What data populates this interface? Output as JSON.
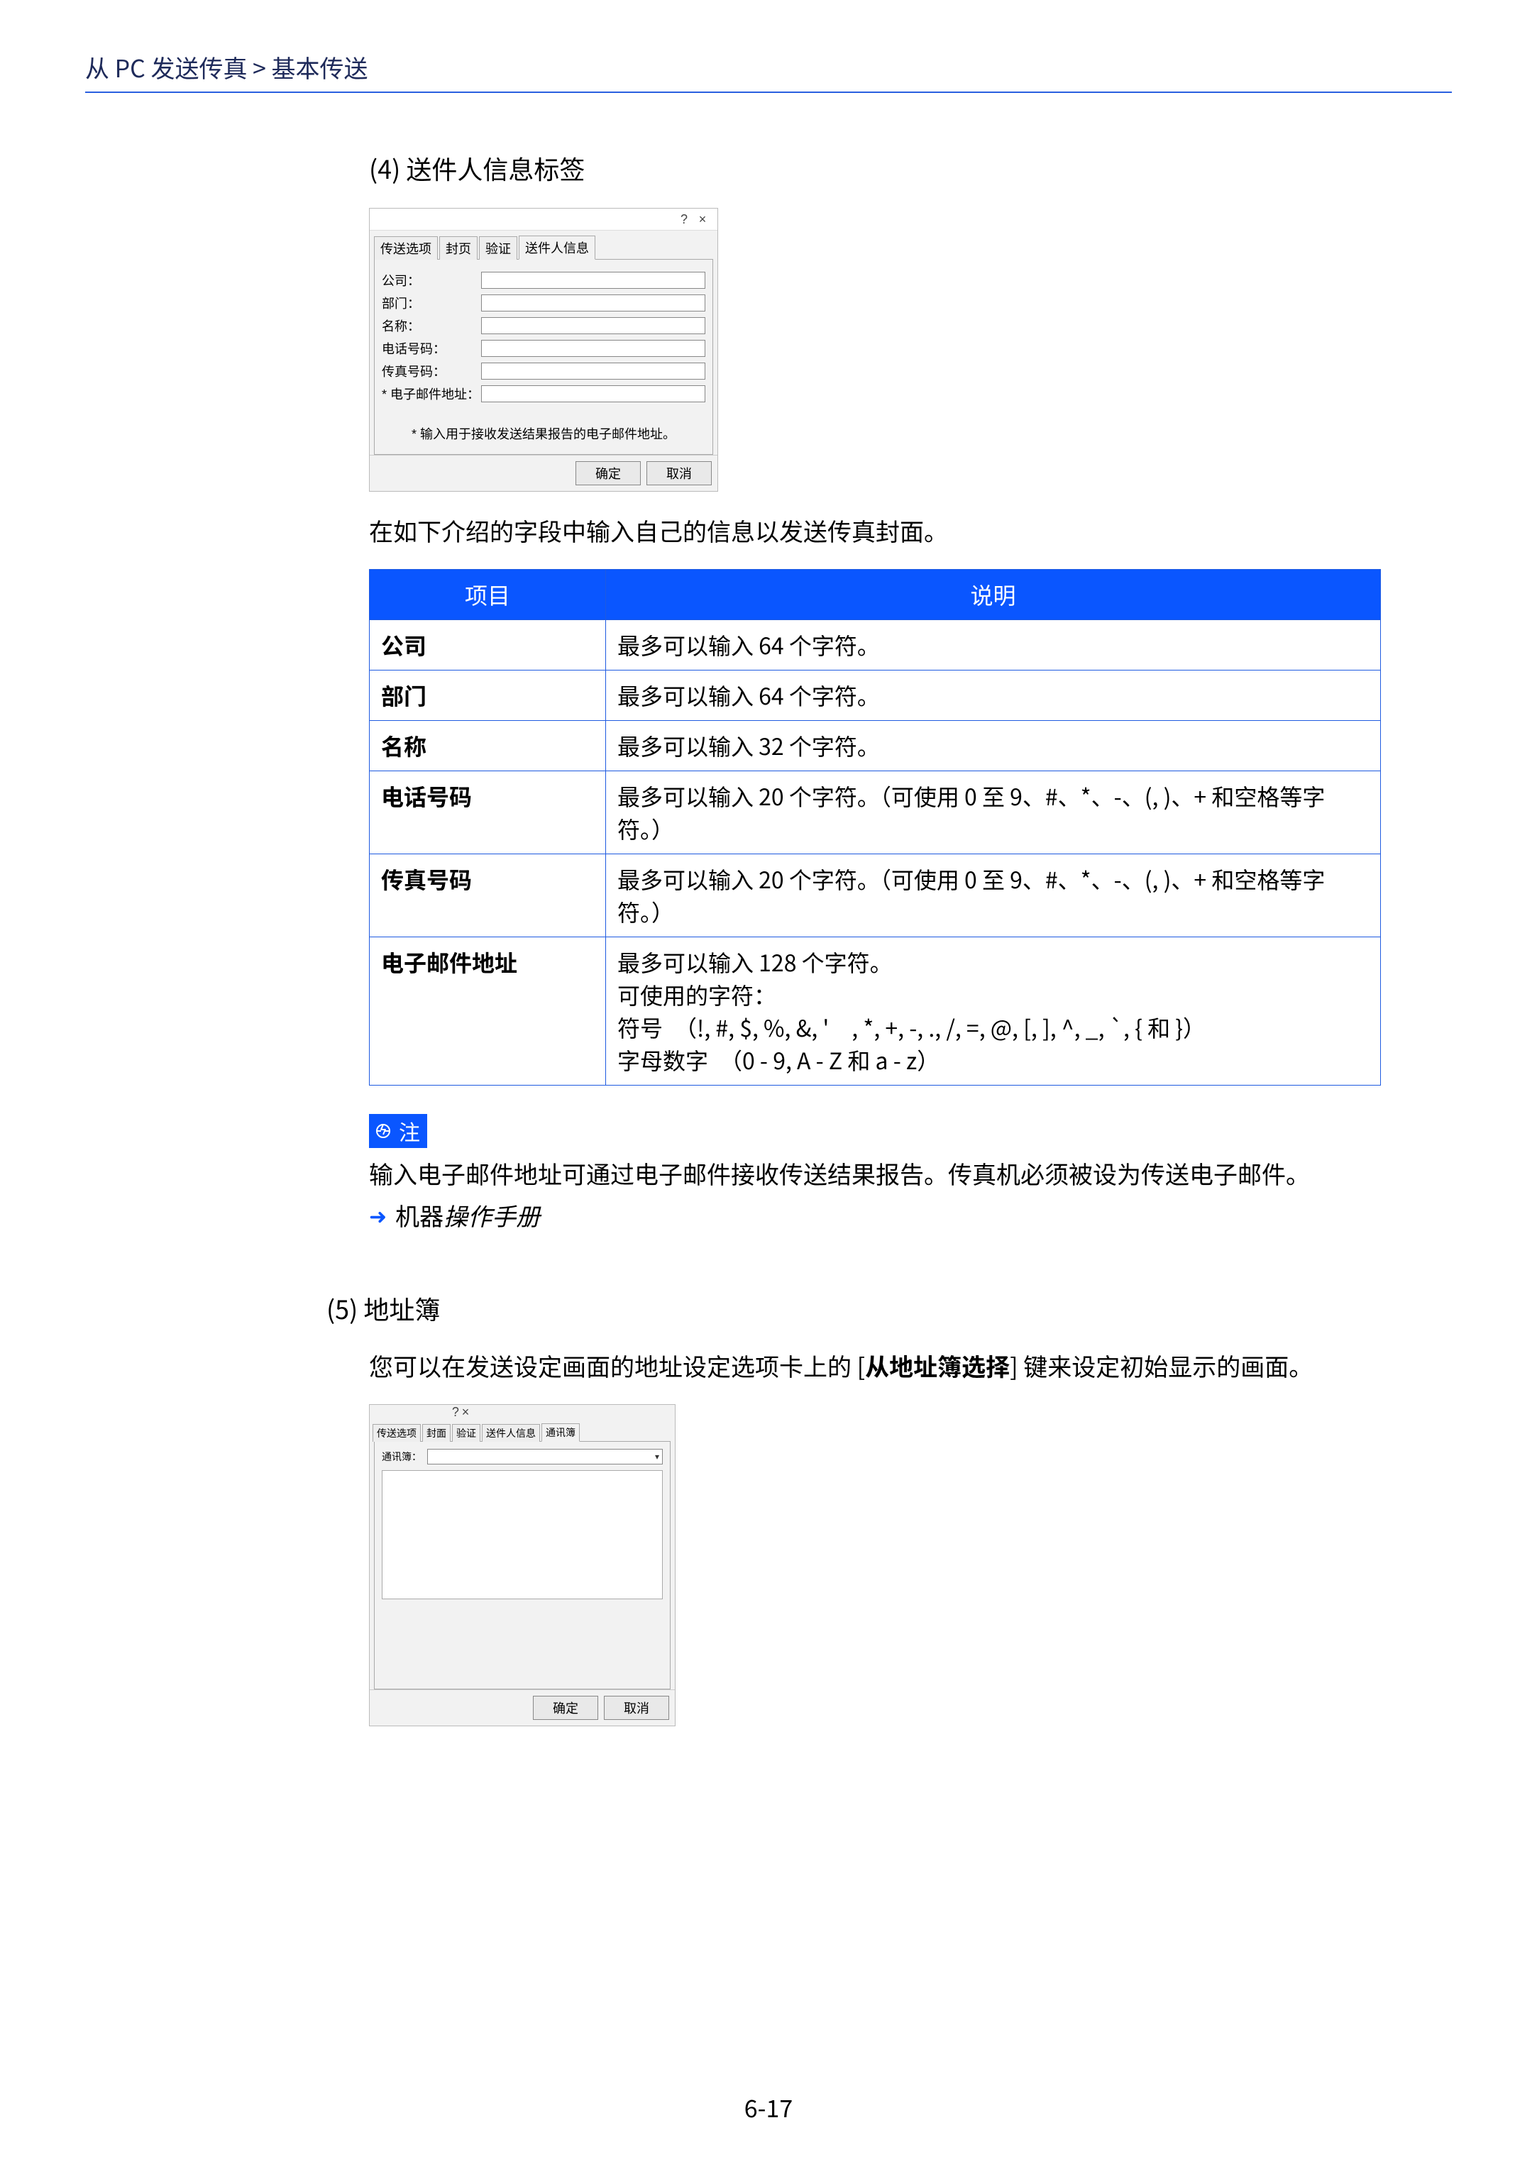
{
  "breadcrumb": "从 PC 发送传真 > 基本传送",
  "section4": {
    "heading": "(4) 送件人信息标签",
    "dialog": {
      "help": "?",
      "close": "×",
      "tabs": {
        "t1": "传送选项",
        "t2": "封页",
        "t3": "验证",
        "t4": "送件人信息"
      },
      "fields": {
        "company": "公司：",
        "dept": "部门：",
        "name": "名称：",
        "phone": "电话号码：",
        "fax": "传真号码：",
        "email": "* 电子邮件地址："
      },
      "footnote": "* 输入用于接收发送结果报告的电子邮件地址。",
      "ok": "确定",
      "cancel": "取消"
    },
    "para": "在如下介绍的字段中输入自己的信息以发送传真封面。",
    "table": {
      "h1": "项目",
      "h2": "说明",
      "rows": [
        {
          "k": "公司",
          "v": "最多可以输入 64 个字符。"
        },
        {
          "k": "部门",
          "v": "最多可以输入 64 个字符。"
        },
        {
          "k": "名称",
          "v": "最多可以输入 32 个字符。"
        },
        {
          "k": "电话号码",
          "v": "最多可以输入 20 个字符。（可使用 0 至 9、#、*、-、(, )、+ 和空格等字符。）"
        },
        {
          "k": "传真号码",
          "v": "最多可以输入 20 个字符。（可使用 0 至 9、#、*、-、(, )、+ 和空格等字符。）"
        },
        {
          "k": "电子邮件地址",
          "v": "最多可以输入 128 个字符。\n可使用的字符：\n符号　（!, #, $, %, &, '　, *, +, -, ., /, =, @, [, ], ^, _, `, { 和 }）\n字母数字　（0 - 9, A - Z 和 a - z）"
        }
      ]
    },
    "note": {
      "label": "注",
      "body": "输入电子邮件地址可通过电子邮件接收传送结果报告。传真机必须被设为传送电子邮件。",
      "ref_prefix": "机器",
      "ref_italic": "操作手册"
    }
  },
  "section5": {
    "heading": "(5) 地址簿",
    "para_before": "您可以在发送设定画面的地址设定选项卡上的 [",
    "para_bold": "从地址簿选择",
    "para_after": "] 键来设定初始显示的画面。",
    "dialog": {
      "help": "?",
      "close": "×",
      "tabs": {
        "t1": "传送选项",
        "t2": "封面",
        "t3": "验证",
        "t4": "送件人信息",
        "t5": "通讯簿"
      },
      "label": "通讯簿：",
      "ok": "确定",
      "cancel": "取消"
    }
  },
  "page_number": "6-17"
}
